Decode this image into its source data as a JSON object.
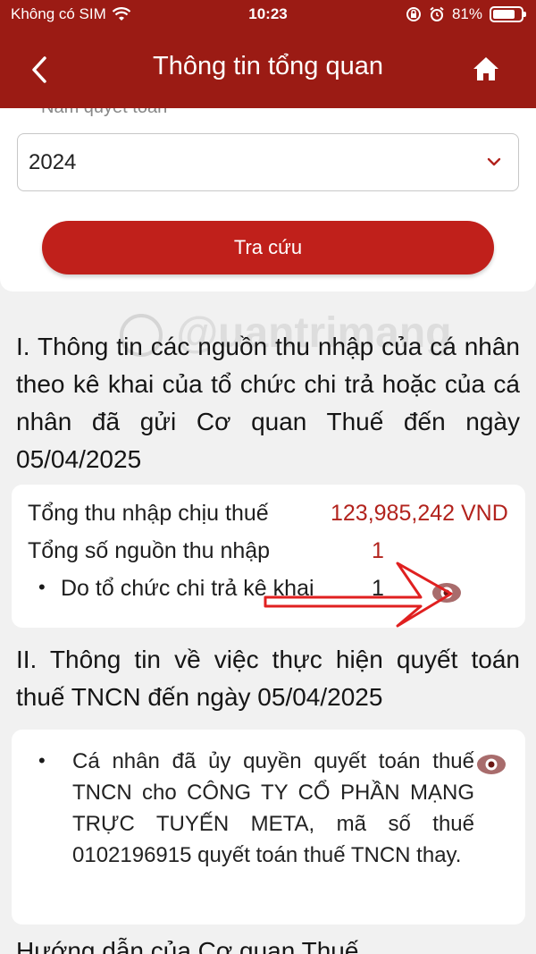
{
  "status_bar": {
    "carrier": "Không có SIM",
    "time": "10:23",
    "battery_percent": "81%",
    "battery_level": 0.81
  },
  "header": {
    "title": "Thông tin tổng quan",
    "back_icon": "chevron-left-icon",
    "home_icon": "home-icon"
  },
  "form": {
    "year_label": "Năm quyết toán",
    "year_value": "2024",
    "search_label": "Tra cứu"
  },
  "section1": {
    "heading": "I. Thông tin các nguồn thu nhập của cá nhân theo kê khai của tổ chức chi trả hoặc của cá nhân đã gửi Cơ quan Thuế đến ngày 05/04/2025",
    "total_income_label": "Tổng thu nhập chịu thuế",
    "total_income_value": "123,985,242 VND",
    "source_count_label": "Tổng số nguồn thu nhập",
    "source_count_value": "1",
    "by_org_label": "Do tổ chức chi trả kê khai",
    "by_org_value": "1"
  },
  "section2": {
    "heading": "II. Thông tin về việc thực hiện quyết toán thuế TNCN đến ngày 05/04/2025",
    "detail": "Cá nhân đã ủy quyền quyết toán thuế TNCN cho CÔNG TY CỔ PHẦN MẠNG TRỰC TUYẾN META, mã số thuế 0102196915 quyết toán thuế TNCN thay."
  },
  "section3": {
    "heading": "Hướng dẫn của Cơ quan Thuế"
  },
  "watermark": "@uantrimang",
  "colors": {
    "brand": "#9b1b14",
    "button": "#c0201b",
    "value_red": "#b2231d",
    "background": "#f1f1f1"
  }
}
